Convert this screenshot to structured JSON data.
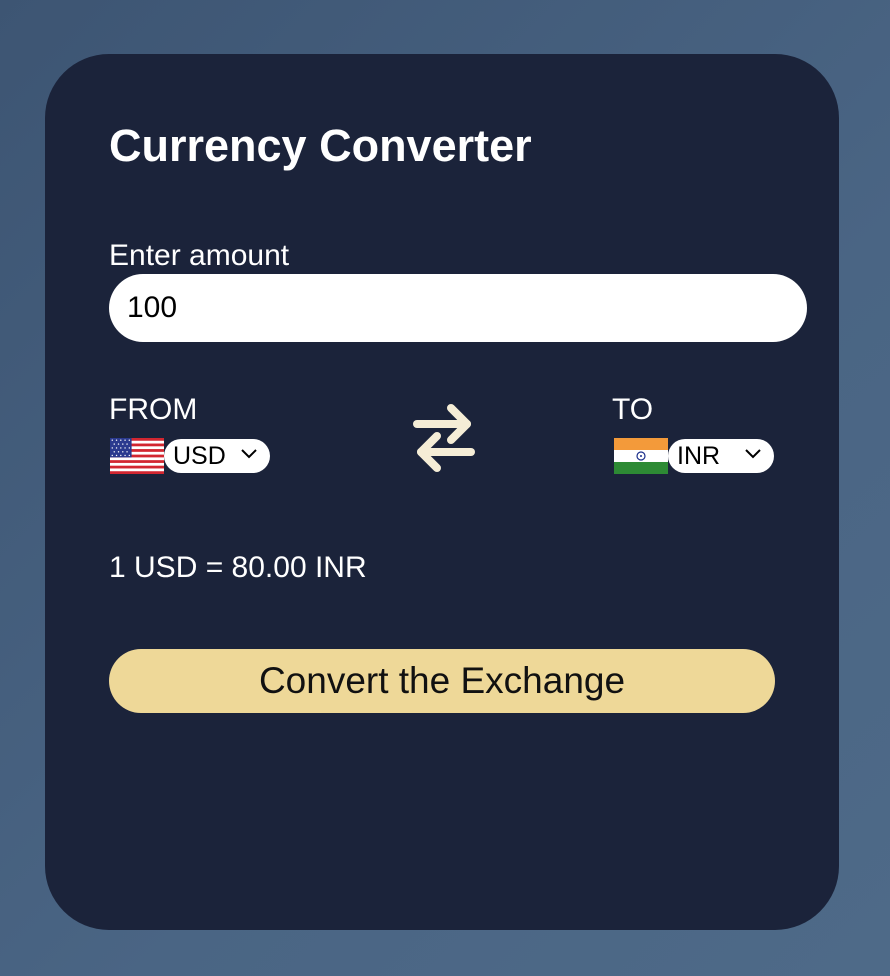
{
  "converter": {
    "title": "Currency Converter",
    "amount_label": "Enter amount",
    "amount_value": "100",
    "from": {
      "label": "FROM",
      "currency": "USD",
      "flag_icon": "us-flag-icon"
    },
    "to": {
      "label": "TO",
      "currency": "INR",
      "flag_icon": "india-flag-icon"
    },
    "rate_text": "1 USD = 80.00 INR",
    "convert_label": "Convert the Exchange"
  },
  "colors": {
    "background": "#4a6584",
    "card": "#1b233a",
    "button": "#eed898",
    "swap_icon": "#f5edd6",
    "text": "#ffffff"
  }
}
